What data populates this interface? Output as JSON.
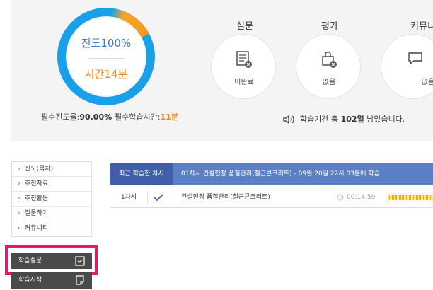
{
  "progress": {
    "progress_label": "진도100%",
    "progress_value": 1.0,
    "time_label": "시간14분",
    "ring_outer_color": "#1aa0e8",
    "ring_accent_color": "#f5861f"
  },
  "requirements": {
    "required_progress_label": "필수진도율:",
    "required_progress_value": "90.00%",
    "required_time_label": "필수학습시간:",
    "required_time_value": "11분"
  },
  "categories": [
    {
      "title": "설문",
      "status": "미완료",
      "icon": "survey-list-icon"
    },
    {
      "title": "평가",
      "status": "없음",
      "icon": "evaluation-lock-icon"
    },
    {
      "title": "커뮤니",
      "status": "없음",
      "icon": "community-chat-icon"
    }
  ],
  "notice": {
    "prefix": "학습기간 총",
    "days": "102일",
    "suffix": "남았습니다."
  },
  "menu": {
    "items": [
      {
        "label": "진도(목차)"
      },
      {
        "label": "추천자료"
      },
      {
        "label": "추천활동"
      },
      {
        "label": "질문하기"
      },
      {
        "label": "커뮤니티"
      }
    ],
    "survey_button": "학습설문",
    "start_button": "학습시작"
  },
  "recent": {
    "header_label": "최근 학습한 차시",
    "header_info": "01차시 건설현장 품질관리(철근콘크리트) - 09월 20일 22시 03분에 학습",
    "row": {
      "session": "1차시",
      "title": "건설현장 품질관리(철근콘크리트)",
      "duration": "00:14:59"
    }
  }
}
